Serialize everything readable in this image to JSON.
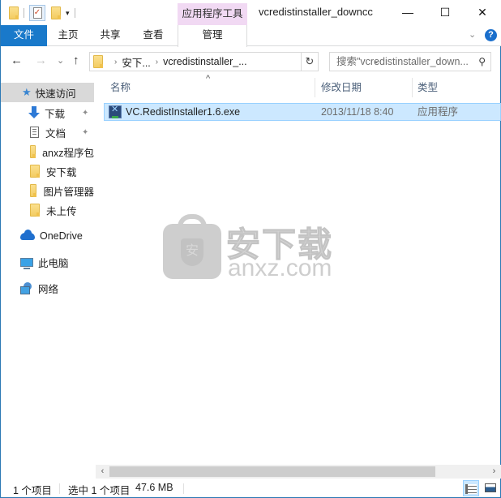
{
  "window": {
    "title": "vcredistinstaller_downcc",
    "minimize_label": "—",
    "maximize_label": "☐",
    "close_label": "✕"
  },
  "quick_access_toolbar": {
    "properties_glyph": "✓",
    "dropdown_glyph": "▾"
  },
  "ribbon": {
    "contextual_group": "应用程序工具",
    "tabs": [
      {
        "label": "文件"
      },
      {
        "label": "主页"
      },
      {
        "label": "共享"
      },
      {
        "label": "查看"
      },
      {
        "label": "管理"
      }
    ],
    "expand_glyph": "⌄",
    "help_glyph": "?"
  },
  "nav": {
    "back_glyph": "←",
    "forward_glyph": "→",
    "recent_glyph": "⌄",
    "up_glyph": "↑",
    "breadcrumb": [
      "安下...",
      "vcredistinstaller_..."
    ],
    "breadcrumb_sep": "›",
    "address_dropdown_glyph": "⌄",
    "refresh_glyph": "↻",
    "search_placeholder": "搜索\"vcredistinstaller_down...",
    "search_glyph": "⚲"
  },
  "sidebar": {
    "items": [
      {
        "label": "快速访问",
        "icon": "star-icon",
        "selected": true
      },
      {
        "label": "下载",
        "icon": "download-icon",
        "pinned": true
      },
      {
        "label": "文档",
        "icon": "document-icon",
        "pinned": true
      },
      {
        "label": "anxz程序包",
        "icon": "folder-icon"
      },
      {
        "label": "安下载",
        "icon": "folder-icon"
      },
      {
        "label": "图片管理器",
        "icon": "folder-icon"
      },
      {
        "label": "未上传",
        "icon": "folder-icon"
      },
      {
        "label": "OneDrive",
        "icon": "onedrive-icon"
      },
      {
        "label": "此电脑",
        "icon": "this-pc-icon"
      },
      {
        "label": "网络",
        "icon": "network-icon"
      }
    ],
    "pin_glyph": "📌"
  },
  "file_list": {
    "columns": [
      {
        "label": "名称"
      },
      {
        "label": "修改日期"
      },
      {
        "label": "类型"
      }
    ],
    "sort_glyph": "^",
    "rows": [
      {
        "name": "VC.RedistInstaller1.6.exe",
        "modified": "2013/11/18 8:40",
        "type": "应用程序",
        "selected": true
      }
    ]
  },
  "watermark": {
    "shield_char": "安",
    "cn_text": "安下载",
    "en_text": "anxz.com"
  },
  "scrollbar": {
    "left_glyph": "‹",
    "right_glyph": "›"
  },
  "status_bar": {
    "item_count": "1 个项目",
    "selection": "选中 1 个项目",
    "size": "47.6 MB",
    "view_mode": "details"
  }
}
